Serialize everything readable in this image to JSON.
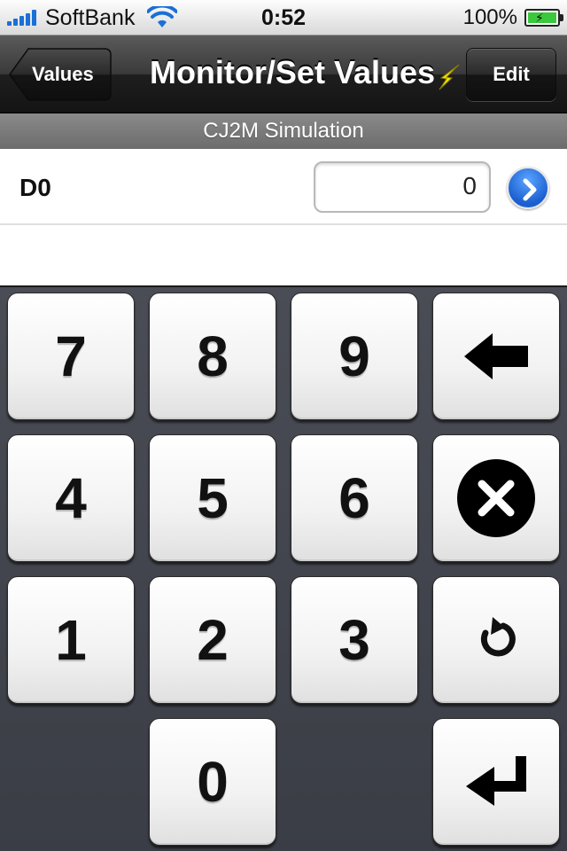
{
  "status_bar": {
    "carrier": "SoftBank",
    "time": "0:52",
    "battery": "100%",
    "battery_level": 1.0
  },
  "nav": {
    "back_label": "Values",
    "title": "Monitor/Set Values",
    "edit_label": "Edit"
  },
  "section": {
    "header": "CJ2M Simulation"
  },
  "rows": [
    {
      "label": "D0",
      "value": "0"
    }
  ],
  "keypad": {
    "keys": [
      "7",
      "8",
      "9",
      "4",
      "5",
      "6",
      "1",
      "2",
      "3",
      "0"
    ],
    "icons": [
      "backspace-icon",
      "clear-icon",
      "undo-icon",
      "enter-icon"
    ]
  },
  "colors": {
    "accent_blue": "#1b5fd0",
    "keypad_bg": "#3e414a",
    "bolt_yellow": "#f2e600"
  }
}
